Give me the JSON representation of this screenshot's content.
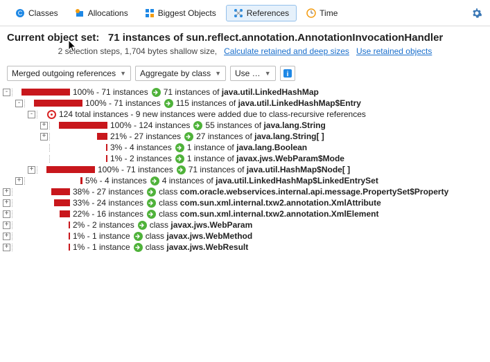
{
  "tabs": {
    "classes": "Classes",
    "allocations": "Allocations",
    "biggest": "Biggest Objects",
    "references": "References",
    "time": "Time"
  },
  "header": {
    "label": "Current object set:",
    "value": "71 instances of sun.reflect.annotation.AnnotationInvocationHandler",
    "sub_prefix": "2 selection steps, 1,704 bytes shallow size,",
    "link1": "Calculate retained and deep sizes",
    "link2": "Use retained objects"
  },
  "toolbar": {
    "merged": "Merged outgoing references",
    "aggregate": "Aggregate by class",
    "use": "Use …"
  },
  "tree": [
    {
      "indent": 0,
      "toggle": "-",
      "bar": 100,
      "pct": "100% - 71 instances",
      "icon": "green",
      "text_plain": "71 instances of ",
      "text_bold": "java.util.LinkedHashMap"
    },
    {
      "indent": 1,
      "toggle": "-",
      "bar": 100,
      "pct": "100% - 71 instances",
      "icon": "green",
      "text_plain": "115 instances of ",
      "text_bold": "java.util.LinkedHashMap$Entry"
    },
    {
      "indent": 2,
      "toggle": "-",
      "bar": 0,
      "pct": "",
      "icon": "red",
      "text_plain": "124 total instances - 9 new instances were added due to class-recursive references",
      "text_bold": ""
    },
    {
      "indent": 3,
      "toggle": "+",
      "bar": 100,
      "pct": "100% - 124 instances",
      "icon": "green",
      "text_plain": "55 instances of ",
      "text_bold": "java.lang.String"
    },
    {
      "indent": 3,
      "toggle": "+",
      "bar": 21,
      "pct": "21% - 27 instances",
      "icon": "green",
      "text_plain": "27 instances of ",
      "text_bold": "java.lang.String[ ]"
    },
    {
      "indent": 3,
      "toggle": " ",
      "bar": 3,
      "pct": "3% - 4 instances",
      "icon": "green",
      "text_plain": "1 instance of ",
      "text_bold": "java.lang.Boolean"
    },
    {
      "indent": 3,
      "toggle": " ",
      "bar": 1,
      "pct": "1% - 2 instances",
      "icon": "green",
      "text_plain": "1 instance of ",
      "text_bold": "javax.jws.WebParam$Mode"
    },
    {
      "indent": 2,
      "toggle": "+",
      "bar": 100,
      "pct": "100% - 71 instances",
      "icon": "green",
      "text_plain": "71 instances of ",
      "text_bold": "java.util.HashMap$Node[ ]"
    },
    {
      "indent": 1,
      "toggle": "+",
      "bar": 5,
      "pct": "5% - 4 instances",
      "icon": "green",
      "text_plain": "4 instances of ",
      "text_bold": "java.util.LinkedHashMap$LinkedEntrySet"
    },
    {
      "indent": 0,
      "toggle": "+",
      "bar": 38,
      "pct": "38% - 27 instances",
      "icon": "green",
      "text_plain": "class ",
      "text_bold": "com.oracle.webservices.internal.api.message.PropertySet$Property"
    },
    {
      "indent": 0,
      "toggle": "+",
      "bar": 33,
      "pct": "33% - 24 instances",
      "icon": "green",
      "text_plain": "class ",
      "text_bold": "com.sun.xml.internal.txw2.annotation.XmlAttribute"
    },
    {
      "indent": 0,
      "toggle": "+",
      "bar": 22,
      "pct": "22% - 16 instances",
      "icon": "green",
      "text_plain": "class ",
      "text_bold": "com.sun.xml.internal.txw2.annotation.XmlElement"
    },
    {
      "indent": 0,
      "toggle": "+",
      "bar": 2,
      "pct": "2% - 2 instances",
      "icon": "green",
      "text_plain": "class ",
      "text_bold": "javax.jws.WebParam"
    },
    {
      "indent": 0,
      "toggle": "+",
      "bar": 1,
      "pct": "1% - 1 instance",
      "icon": "green",
      "text_plain": "class ",
      "text_bold": "javax.jws.WebMethod"
    },
    {
      "indent": 0,
      "toggle": "+",
      "bar": 1,
      "pct": "1% - 1 instance",
      "icon": "green",
      "text_plain": "class ",
      "text_bold": "javax.jws.WebResult"
    }
  ]
}
